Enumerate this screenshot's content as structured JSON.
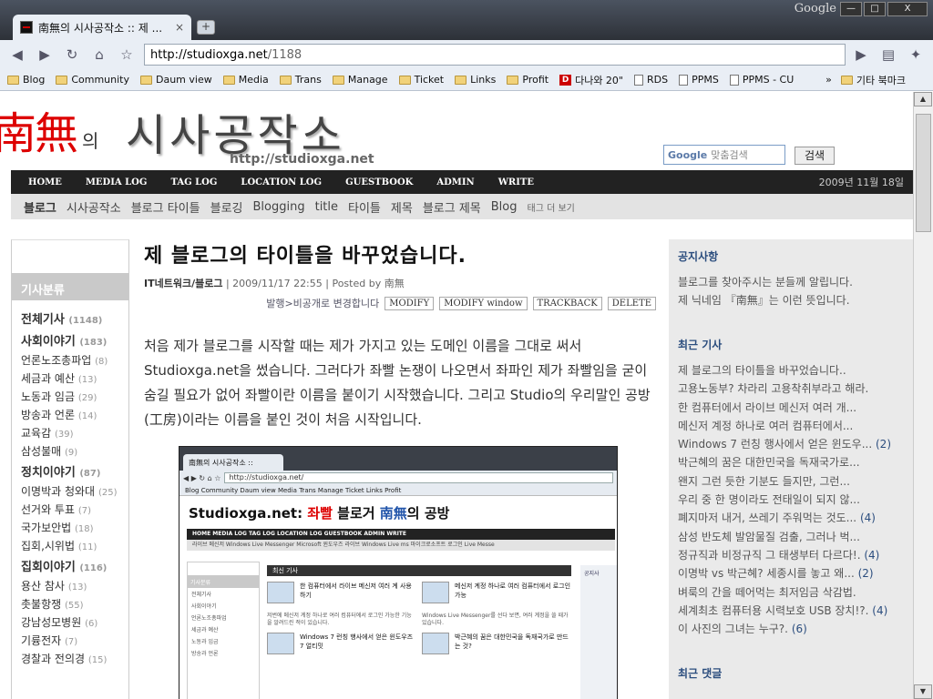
{
  "browser": {
    "brand": "Google",
    "tab_title": "南無의 시사공작소 :: 제 ...",
    "tab_close": "×",
    "new_tab": "+",
    "url_domain": "http://studioxga.net",
    "url_path": "/1188",
    "win_min": "—",
    "win_max": "□",
    "win_close": "X",
    "bookmarks": [
      "Blog",
      "Community",
      "Daum view",
      "Media",
      "Trans",
      "Manage",
      "Ticket",
      "Links",
      "Profit"
    ],
    "bookmark_daum": "다나와 20\"",
    "bookmark_pages": [
      "RDS",
      "PPMS",
      "PPMS - CU"
    ],
    "bookmark_more": "»",
    "bookmark_other": "기타 북마크"
  },
  "header": {
    "logo_nam": "南無",
    "logo_ui": "의",
    "logo_main": "시사공작소",
    "logo_url": "http://studioxga.net",
    "search_logo": "Google",
    "search_placeholder": "맞춤검색",
    "search_button": "검색"
  },
  "nav": {
    "items": [
      "HOME",
      "MEDIA LOG",
      "TAG LOG",
      "LOCATION LOG",
      "GUESTBOOK",
      "ADMIN",
      "WRITE"
    ],
    "date": "2009년 11월 18일"
  },
  "tagbar": {
    "items": [
      "블로그",
      "시사공작소",
      "블로그 타이틀",
      "블로깅",
      "Blogging",
      "title",
      "타이틀",
      "제목",
      "블로그 제목",
      "Blog"
    ],
    "more": "태그 더 보기"
  },
  "left": {
    "category_title": "기사분류",
    "items": [
      {
        "label": "전체기사",
        "count": "(1148)",
        "bold": true
      },
      {
        "label": "사회이야기",
        "count": "(183)",
        "bold": true
      },
      {
        "label": "언론노조총파업",
        "count": "(8)",
        "bold": false
      },
      {
        "label": "세금과 예산",
        "count": "(13)",
        "bold": false
      },
      {
        "label": "노동과 임금",
        "count": "(29)",
        "bold": false
      },
      {
        "label": "방송과 언론",
        "count": "(14)",
        "bold": false
      },
      {
        "label": "교육감",
        "count": "(39)",
        "bold": false
      },
      {
        "label": "삼성불매",
        "count": "(9)",
        "bold": false
      },
      {
        "label": "정치이야기",
        "count": "(87)",
        "bold": true
      },
      {
        "label": "이명박과 청와대",
        "count": "(25)",
        "bold": false
      },
      {
        "label": "선거와 투표",
        "count": "(7)",
        "bold": false
      },
      {
        "label": "국가보안법",
        "count": "(18)",
        "bold": false
      },
      {
        "label": "집회,시위법",
        "count": "(11)",
        "bold": false
      },
      {
        "label": "집회이야기",
        "count": "(116)",
        "bold": true
      },
      {
        "label": "용산 참사",
        "count": "(13)",
        "bold": false
      },
      {
        "label": "촛불항쟁",
        "count": "(55)",
        "bold": false
      },
      {
        "label": "강남성모병원",
        "count": "(6)",
        "bold": false
      },
      {
        "label": "기륭전자",
        "count": "(7)",
        "bold": false
      },
      {
        "label": "경찰과 전의경",
        "count": "(15)",
        "bold": false
      }
    ]
  },
  "article": {
    "title": "제 블로그의 타이틀을 바꾸었습니다.",
    "category": "IT네트워크/블로그",
    "meta_rest": " | 2009/11/17 22:55 | Posted by 南無",
    "actions_text": "발행>비공개로 변경합니다",
    "btn_modify": "MODIFY",
    "btn_modify_window": "MODIFY window",
    "btn_trackback": "TRACKBACK",
    "btn_delete": "DELETE",
    "body": "처음 제가 블로그를 시작할 때는 제가 가지고 있는 도메인 이름을 그대로 써서 Studioxga.net을 썼습니다. 그러다가 좌빨 논쟁이 나오면서 좌파인 제가 좌빨임을 굳이 숨길 필요가 없어 좌빨이란 이름을 붙이기 시작했습니다. 그리고 Studio의 우리말인 공방(工房)이라는 이름을 붙인 것이 처음 시작입니다."
  },
  "screenshot": {
    "tab": "南無의 시사공작소 ::",
    "url": "http://studioxga.net/",
    "bookmarks": "Blog  Community  Daum view  Media  Trans  Manage  Ticket  Links  Profit",
    "logo_a": "Studioxga.net: ",
    "logo_b": "좌빨",
    "logo_c": " 블로거 ",
    "logo_d": "南無",
    "logo_e": "의 공방",
    "nav": "HOME   MEDIA LOG   TAG LOG   LOCATION LOG   GUESTBOOK   ADMIN   WRITE",
    "tags": "라이브 메신저  Windows Live Messenger  Microsoft  윈도우즈 라이브  Windows Live  ms  마이크로소프트  로그인  Live Messe",
    "left_cat": "기사분류",
    "left_items": [
      "전체기사",
      "사회이야기",
      "언론노조총파업",
      "세금과 예산",
      "노동과 임금",
      "방송과 언론"
    ],
    "main_head": "최신 기사",
    "art1": "한 컴퓨터에서 라이브 메신저 여러 계 사용 하기",
    "art2": "메신저 계정 하나로 여러 컴퓨터에서 로그인 가능",
    "p1": "저번에 메신저 계정 하나로 여러 컴퓨터에서 로그인 가능한 기능을 알려드린 적이 있습니다.",
    "p2": "Windows Live Messenger를 선다 보면, 여러 계정을 쓸 때가 있습니다.",
    "art3": "Windows 7 런칭 행사에서 얻은 윈도우즈 7 얼티밋",
    "art4": "박근혜의 꿈은 대한민국을 독재국가로 만드는 것?",
    "right": "공지사"
  },
  "right": {
    "notice_title": "공지사항",
    "notice_lines": [
      "블로그를 찾아주시는 분들께 알립니다.",
      "제 닉네임 『南無』는 이런 뜻입니다."
    ],
    "recent_title": "최근 기사",
    "recent": [
      {
        "t": "제 블로그의 타이틀을 바꾸었습니다..",
        "n": ""
      },
      {
        "t": "고용노동부? 차라리 고용착취부라고 해라.",
        "n": ""
      },
      {
        "t": "한 컴퓨터에서 라이브 메신저 여러 개...",
        "n": ""
      },
      {
        "t": "메신저 계정 하나로 여러 컴퓨터에서...",
        "n": ""
      },
      {
        "t": "Windows 7 런칭 행사에서 얻은 윈도우...",
        "n": "(2)"
      },
      {
        "t": "박근혜의 꿈은 대한민국을 독재국가로...",
        "n": ""
      },
      {
        "t": "왠지 그런 듯한 기분도 들지만, 그런...",
        "n": ""
      },
      {
        "t": "우리 중 한 명이라도 전태일이 되지 않...",
        "n": ""
      },
      {
        "t": "폐지마저 내거, 쓰레기 주워먹는 것도...",
        "n": "(4)"
      },
      {
        "t": "삼성 반도체 발암물질 검출, 그러나 벅...",
        "n": ""
      },
      {
        "t": "정규직과 비정규직 그 태생부터 다르다!.",
        "n": "(4)"
      },
      {
        "t": "이명박 vs 박근혜? 세종시를 놓고 왜...",
        "n": "(2)"
      },
      {
        "t": "벼룩의 간을 떼어먹는 최저임금 삭감법.",
        "n": ""
      },
      {
        "t": "세계최초 컴퓨터용 시력보호 USB 장치!?.",
        "n": "(4)"
      },
      {
        "t": "이 사진의 그녀는 누구?.",
        "n": "(6)"
      }
    ],
    "comments_title": "최근 댓글"
  }
}
